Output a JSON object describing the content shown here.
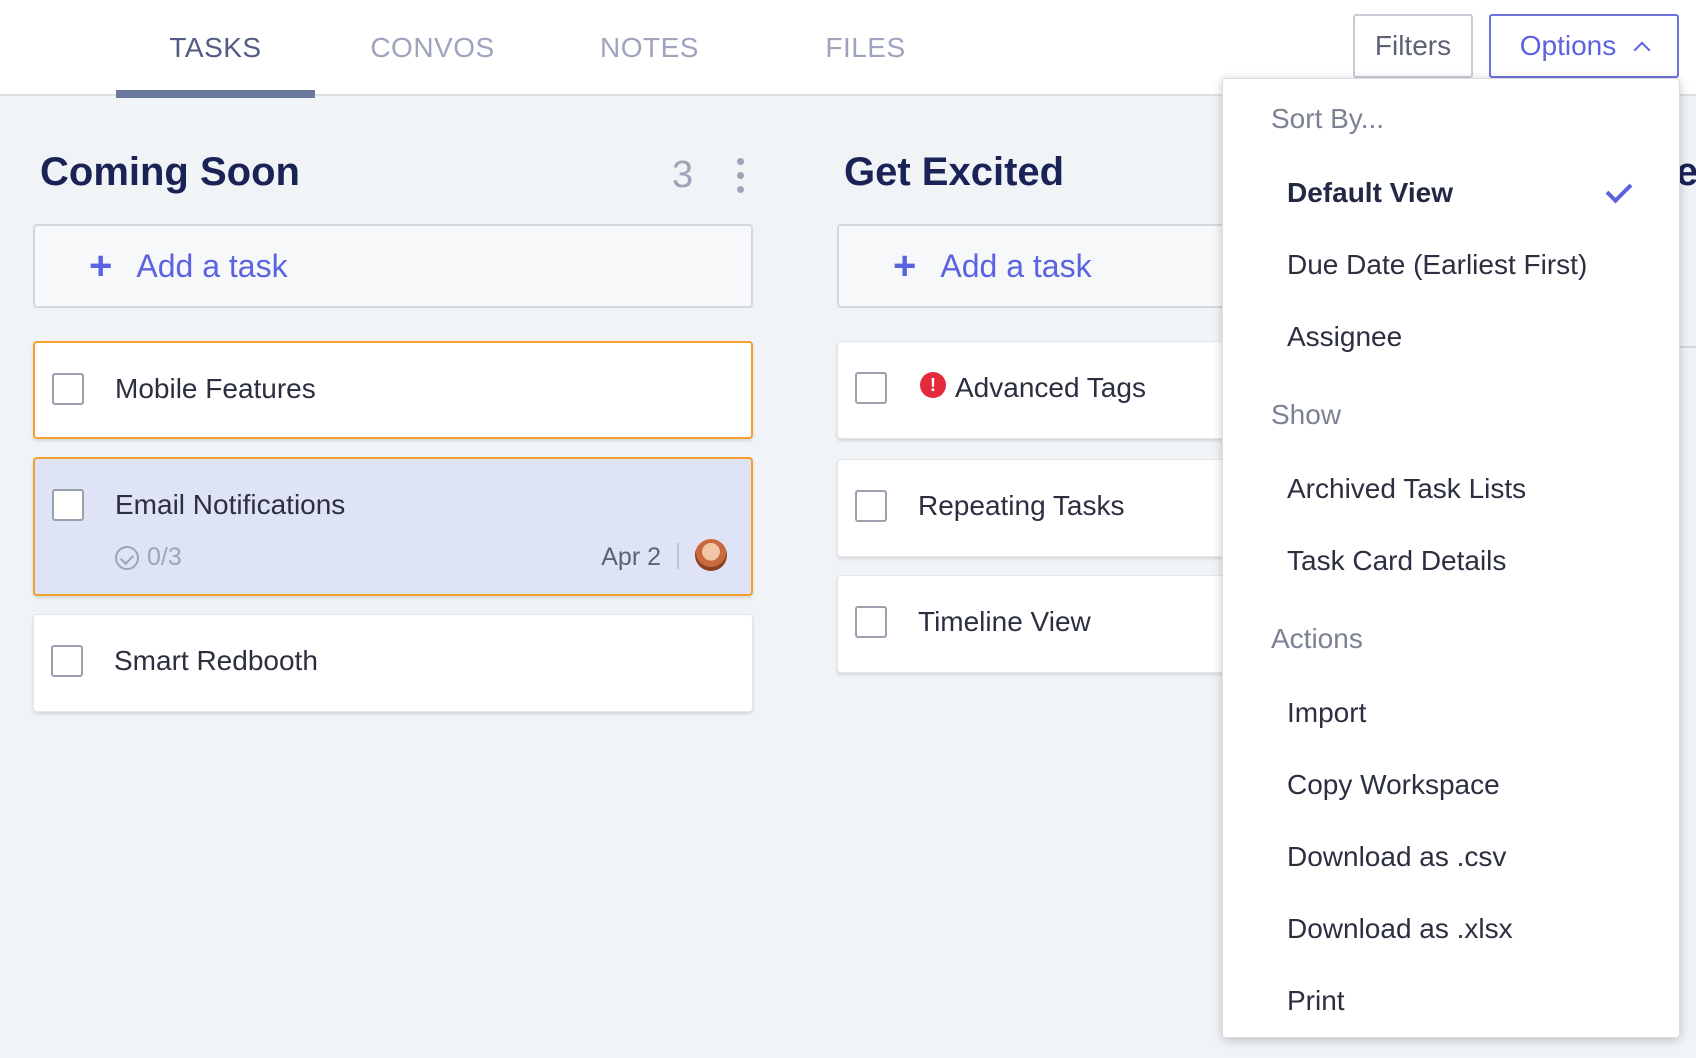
{
  "tabs": [
    {
      "label": "TASKS",
      "active": true
    },
    {
      "label": "CONVOS",
      "active": false
    },
    {
      "label": "NOTES",
      "active": false
    },
    {
      "label": "FILES",
      "active": false
    }
  ],
  "toolbar": {
    "filters_label": "Filters",
    "options_label": "Options"
  },
  "columns": [
    {
      "title": "Coming Soon",
      "count": "3",
      "add_task_label": "Add a task",
      "tasks": [
        {
          "title": "Mobile Features"
        },
        {
          "title": "Email Notifications",
          "subtasks": "0/3",
          "due": "Apr 2"
        },
        {
          "title": "Smart Redbooth"
        }
      ]
    },
    {
      "title": "Get Excited",
      "add_task_label": "Add a task",
      "tasks": [
        {
          "title": "Advanced Tags",
          "alert_icon": "!"
        },
        {
          "title": "Repeating Tasks"
        },
        {
          "title": "Timeline View"
        }
      ]
    }
  ],
  "partial_column_title_fragment": "e",
  "options_menu": {
    "sort_heading": "Sort By...",
    "sort_items": [
      "Default View",
      "Due Date (Earliest First)",
      "Assignee"
    ],
    "sort_selected": "Default View",
    "show_heading": "Show",
    "show_items": [
      "Archived Task Lists",
      "Task Card Details"
    ],
    "actions_heading": "Actions",
    "action_items": [
      "Import",
      "Copy Workspace",
      "Download as .csv",
      "Download as .xlsx",
      "Print"
    ]
  },
  "colors": {
    "accent": "#5b63e0",
    "selected_border": "#f3a12c",
    "highlight_bg": "#dfe3f6",
    "alert": "#e32b3d",
    "title": "#1b2356"
  },
  "icons": [
    "plus-icon",
    "check-icon",
    "kebab-icon",
    "chevron-up-icon",
    "alert-icon",
    "subtask-check-icon"
  ]
}
